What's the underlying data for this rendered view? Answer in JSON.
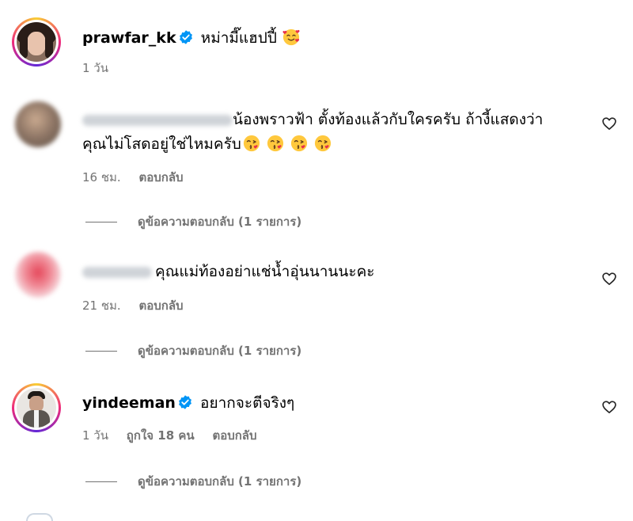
{
  "post": {
    "username": "prawfar_kk",
    "caption": "หม่ามี๊แฮปปี้",
    "time": "1 วัน"
  },
  "comments": [
    {
      "text_line1": "น้องพราวฟ้า ตั้งท้องแล้วกับใครครับ ถ้างี้แสดงว่า",
      "text_line2": "คุณไม่โสดอยู่ใช่ไหมครับ",
      "time": "16 ชม.",
      "reply_label": "ตอบกลับ",
      "view_replies": "ดูข้อความตอบกลับ (1 รายการ)"
    },
    {
      "text": "คุณแม่ท้องอย่าแช่น้ำอุ่นนานนะคะ",
      "time": "21 ชม.",
      "reply_label": "ตอบกลับ",
      "view_replies": "ดูข้อความตอบกลับ (1 รายการ)"
    },
    {
      "username": "yindeeman",
      "text": "อยากจะตีจริงๆ",
      "time": "1 วัน",
      "likes": "ถูกใจ 18 คน",
      "reply_label": "ตอบกลับ",
      "view_replies": "ดูข้อความตอบกลับ (1 รายการ)"
    }
  ],
  "colors": {
    "verified": "#0095f6",
    "secondary_text": "#737373",
    "story_ring": [
      "#f9ce34",
      "#ee2a7b",
      "#6228d7"
    ]
  },
  "icons": {
    "heart": "heart-outline-icon",
    "verified": "verified-badge-icon",
    "emoji_post": "smiling-face-with-hearts-emoji",
    "emoji_comment": "face-blowing-kiss-emoji"
  }
}
